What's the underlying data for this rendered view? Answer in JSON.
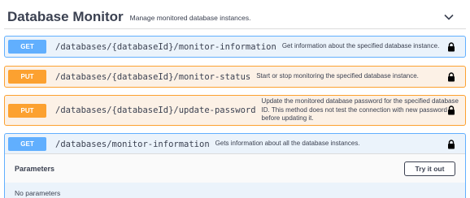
{
  "section": {
    "title": "Database Monitor",
    "description": "Manage monitored database instances."
  },
  "operations": [
    {
      "method": "GET",
      "path": "/databases/{databaseId}/monitor-information",
      "summary": "Get information about the specified database instance."
    },
    {
      "method": "PUT",
      "path": "/databases/{databaseId}/monitor-status",
      "summary": "Start or stop monitoring the specified database instance."
    },
    {
      "method": "PUT",
      "path": "/databases/{databaseId}/update-password",
      "summary": "Update the monitored database password for the specified database ID. This method does not test the connection with new password before updating it."
    },
    {
      "method": "GET",
      "path": "/databases/monitor-information",
      "summary": "Gets information about all the database instances."
    }
  ],
  "parameters": {
    "title": "Parameters",
    "try_label": "Try it out",
    "empty_text": "No parameters"
  },
  "icons": {
    "expand": "chevron-down-icon",
    "lock": "lock-icon"
  },
  "colors": {
    "get": "#61affe",
    "put": "#fca130"
  }
}
